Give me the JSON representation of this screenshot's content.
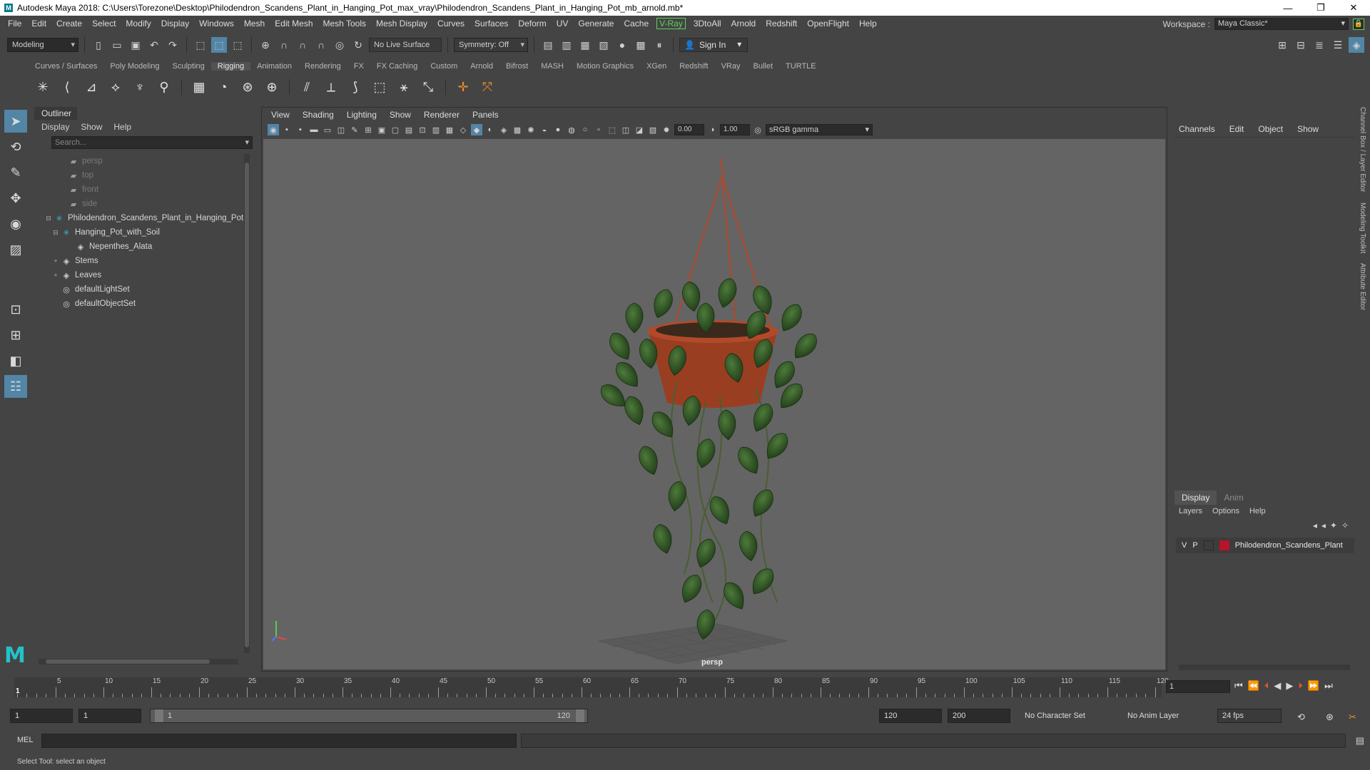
{
  "window": {
    "title": "Autodesk Maya 2018: C:\\Users\\Torezone\\Desktop\\Philodendron_Scandens_Plant_in_Hanging_Pot_max_vray\\Philodendron_Scandens_Plant_in_Hanging_Pot_mb_arnold.mb*",
    "minimize": "—",
    "maximize": "❐",
    "close": "✕"
  },
  "menubar": {
    "items": [
      "File",
      "Edit",
      "Create",
      "Select",
      "Modify",
      "Display",
      "Windows",
      "Mesh",
      "Edit Mesh",
      "Mesh Tools",
      "Mesh Display",
      "Curves",
      "Surfaces",
      "Deform",
      "UV",
      "Generate",
      "Cache",
      "V-Ray",
      "3DtoAll",
      "Arnold",
      "Redshift",
      "OpenFlight",
      "Help"
    ],
    "workspace_label": "Workspace :",
    "workspace_value": "Maya Classic*"
  },
  "statusline": {
    "menuset": "Modeling",
    "live_surface": "No Live Surface",
    "symmetry": "Symmetry: Off",
    "sign_in": "Sign In"
  },
  "shelf_tabs": {
    "items": [
      "Curves / Surfaces",
      "Poly Modeling",
      "Sculpting",
      "Rigging",
      "Animation",
      "Rendering",
      "FX",
      "FX Caching",
      "Custom",
      "Arnold",
      "Bifrost",
      "MASH",
      "Motion Graphics",
      "XGen",
      "Redshift",
      "VRay",
      "Bullet",
      "TURTLE"
    ],
    "active": "Rigging"
  },
  "outliner": {
    "title": "Outliner",
    "menu": [
      "Display",
      "Show",
      "Help"
    ],
    "search_placeholder": "Search...",
    "items": [
      {
        "label": "persp",
        "icon": "camera-icon"
      },
      {
        "label": "top",
        "icon": "camera-icon"
      },
      {
        "label": "front",
        "icon": "camera-icon"
      },
      {
        "label": "side",
        "icon": "camera-icon"
      },
      {
        "label": "Philodendron_Scandens_Plant_in_Hanging_Pot",
        "icon": "group-icon"
      },
      {
        "label": "Hanging_Pot_with_Soil",
        "icon": "group-icon"
      },
      {
        "label": "Nepenthes_Alata",
        "icon": "mesh-icon"
      },
      {
        "label": "Stems",
        "icon": "mesh-icon"
      },
      {
        "label": "Leaves",
        "icon": "mesh-icon"
      },
      {
        "label": "defaultLightSet",
        "icon": "set-icon"
      },
      {
        "label": "defaultObjectSet",
        "icon": "set-icon"
      }
    ]
  },
  "viewport": {
    "menu": [
      "View",
      "Shading",
      "Lighting",
      "Show",
      "Renderer",
      "Panels"
    ],
    "exposure": "0.00",
    "gamma": "1.00",
    "colorspace": "sRGB gamma",
    "camera": "persp"
  },
  "channelbox": {
    "menu": [
      "Channels",
      "Edit",
      "Object",
      "Show"
    ],
    "side_tabs": [
      "Channel Box / Layer Editor",
      "Modeling Toolkit",
      "Attribute Editor"
    ]
  },
  "layers": {
    "tabs": [
      "Display",
      "Anim"
    ],
    "menu": [
      "Layers",
      "Options",
      "Help"
    ],
    "row": {
      "v": "V",
      "p": "P",
      "name": "Philodendron_Scandens_Plant",
      "color": "#b8132a"
    }
  },
  "timeline": {
    "tick_labels": [
      "5",
      "10",
      "15",
      "20",
      "25",
      "30",
      "35",
      "40",
      "45",
      "50",
      "55",
      "60",
      "65",
      "70",
      "75",
      "80",
      "85",
      "90",
      "95",
      "100",
      "105",
      "110",
      "115",
      "120"
    ],
    "current_marker": "1",
    "current_frame": "1"
  },
  "range": {
    "start": "1",
    "playback_start": "1",
    "bar_start": "1",
    "bar_end": "120",
    "playback_end": "120",
    "end": "200",
    "character_set": "No Character Set",
    "anim_layer": "No Anim Layer",
    "fps": "24 fps"
  },
  "cmdline": {
    "mel": "MEL"
  },
  "helpline": {
    "text": "Select Tool: select an object"
  }
}
